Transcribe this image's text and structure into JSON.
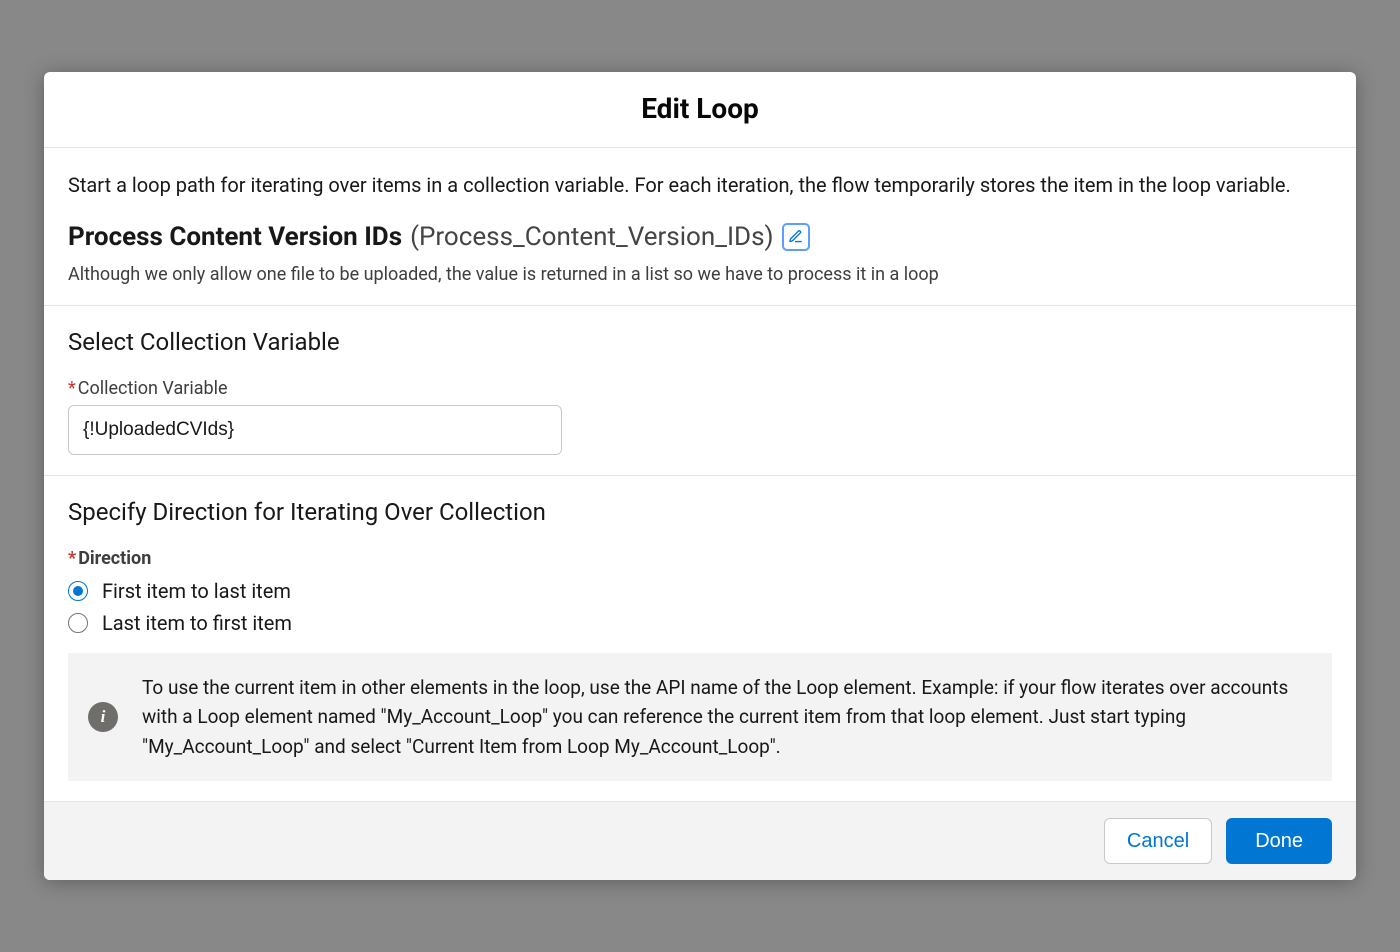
{
  "modal": {
    "title": "Edit Loop",
    "intro": "Start a loop path for iterating over items in a collection variable. For each iteration, the flow temporarily stores the item in the loop variable.",
    "label_name": "Process Content Version IDs",
    "api_name": "(Process_Content_Version_IDs)",
    "description": "Although we only allow one file to be uploaded, the value is returned in a list so we have to process it in a loop"
  },
  "collection": {
    "heading": "Select Collection Variable",
    "field_label": "Collection Variable",
    "value": "{!UploadedCVIds}"
  },
  "direction": {
    "heading": "Specify Direction for Iterating Over Collection",
    "legend": "Direction",
    "options": [
      {
        "label": "First item to last item",
        "value": "first",
        "checked": true
      },
      {
        "label": "Last item to first item",
        "value": "last",
        "checked": false
      }
    ]
  },
  "info": {
    "text": "To use the current item in other elements in the loop, use the API name of the Loop element. Example: if your flow iterates over accounts with a Loop element named \"My_Account_Loop\" you can reference the current item from that loop element. Just start typing \"My_Account_Loop\" and select \"Current Item from Loop My_Account_Loop\"."
  },
  "footer": {
    "cancel": "Cancel",
    "done": "Done"
  }
}
